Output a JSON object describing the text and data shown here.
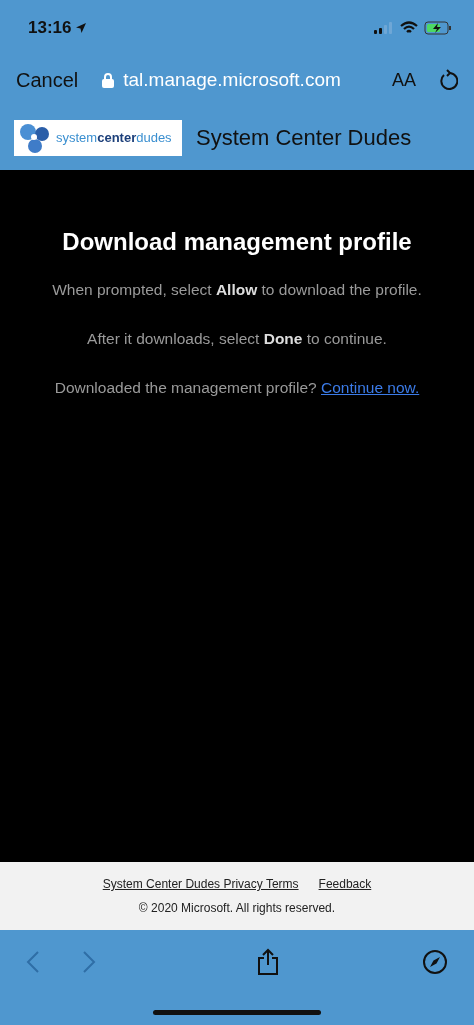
{
  "status_bar": {
    "time": "13:16"
  },
  "browser_bar": {
    "cancel": "Cancel",
    "url": "tal.manage.microsoft.com",
    "text_size": "AA"
  },
  "site_header": {
    "logo_text": "system**center**dudes",
    "title": "System Center Dudes"
  },
  "content": {
    "heading": "Download management profile",
    "paragraphs": [
      {
        "text": "When prompted, select **Allow** to download the profile."
      },
      {
        "text": "After it downloads, select **Done** to continue."
      },
      {
        "text": "Downloaded the management profile?",
        "link": "Continue now."
      }
    ]
  },
  "footer": {
    "links": [
      "System Center Dudes Privacy Terms",
      "Feedback"
    ],
    "copyright": "© 2020 Microsoft. All rights reserved."
  },
  "toolbar": {
    "back": {
      "disabled": true
    },
    "forward": {
      "disabled": true
    }
  }
}
